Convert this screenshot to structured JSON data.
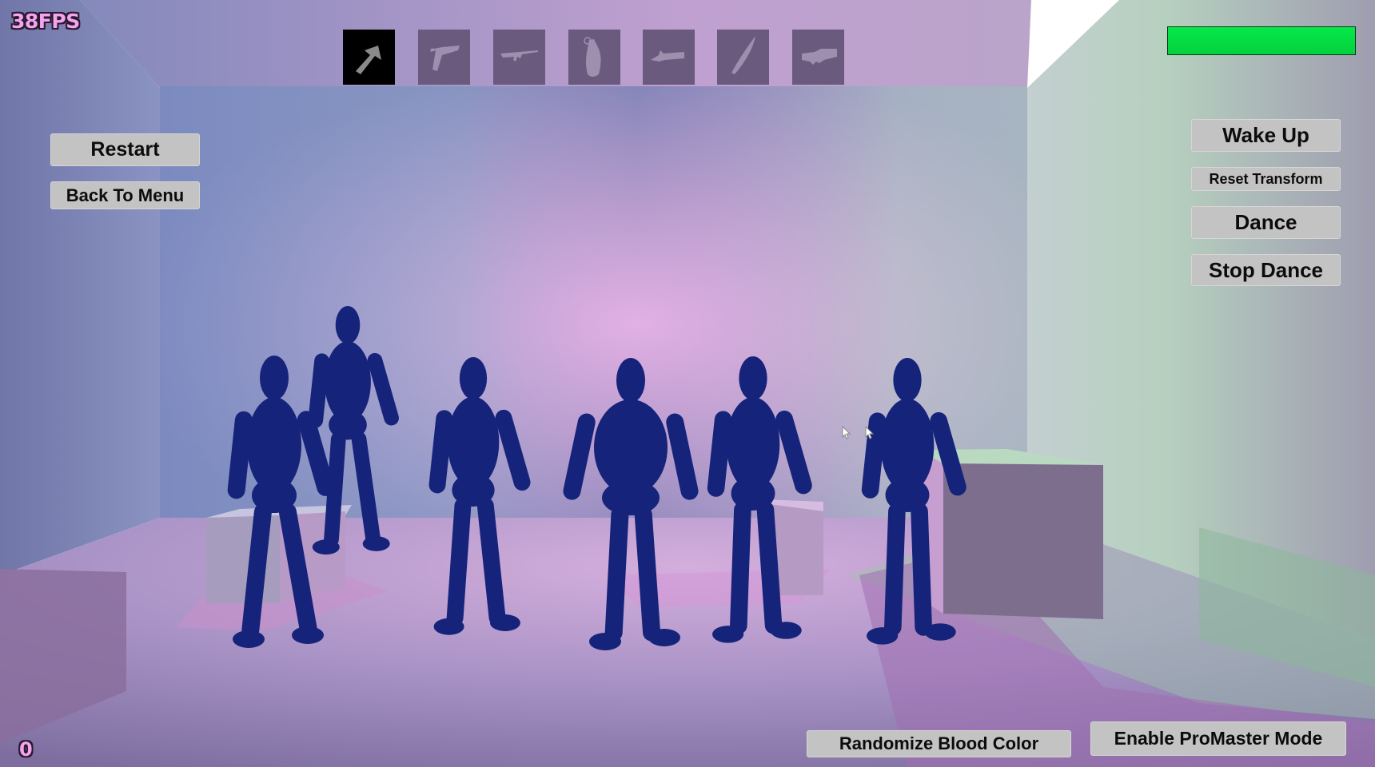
{
  "hud": {
    "fps": "38FPS",
    "score": "0",
    "health": {
      "fraction": 1.0,
      "color": "#04e043"
    }
  },
  "weapons": [
    {
      "name": "hammer",
      "icon": "hammer-icon",
      "selected": true
    },
    {
      "name": "pistol",
      "icon": "pistol-icon",
      "selected": false
    },
    {
      "name": "assault rifle",
      "icon": "rifle-icon",
      "selected": false
    },
    {
      "name": "grenade",
      "icon": "grenade-icon",
      "selected": false
    },
    {
      "name": "minigun",
      "icon": "minigun-icon",
      "selected": false
    },
    {
      "name": "knife",
      "icon": "knife-icon",
      "selected": false
    },
    {
      "name": "launcher",
      "icon": "launcher-icon",
      "selected": false
    }
  ],
  "left_menu": {
    "restart": "Restart",
    "back_to_menu": "Back To Menu"
  },
  "right_menu": {
    "wake_up": "Wake Up",
    "reset_transform": "Reset Transform",
    "dance": "Dance",
    "stop_dance": "Stop Dance"
  },
  "bottom_menu": {
    "randomize_blood": "Randomize Blood Color",
    "promaster": "Enable ProMaster Mode"
  },
  "scene": {
    "ragdoll_count": 6,
    "ragdoll_color": "#15237a",
    "cursors": 2
  }
}
